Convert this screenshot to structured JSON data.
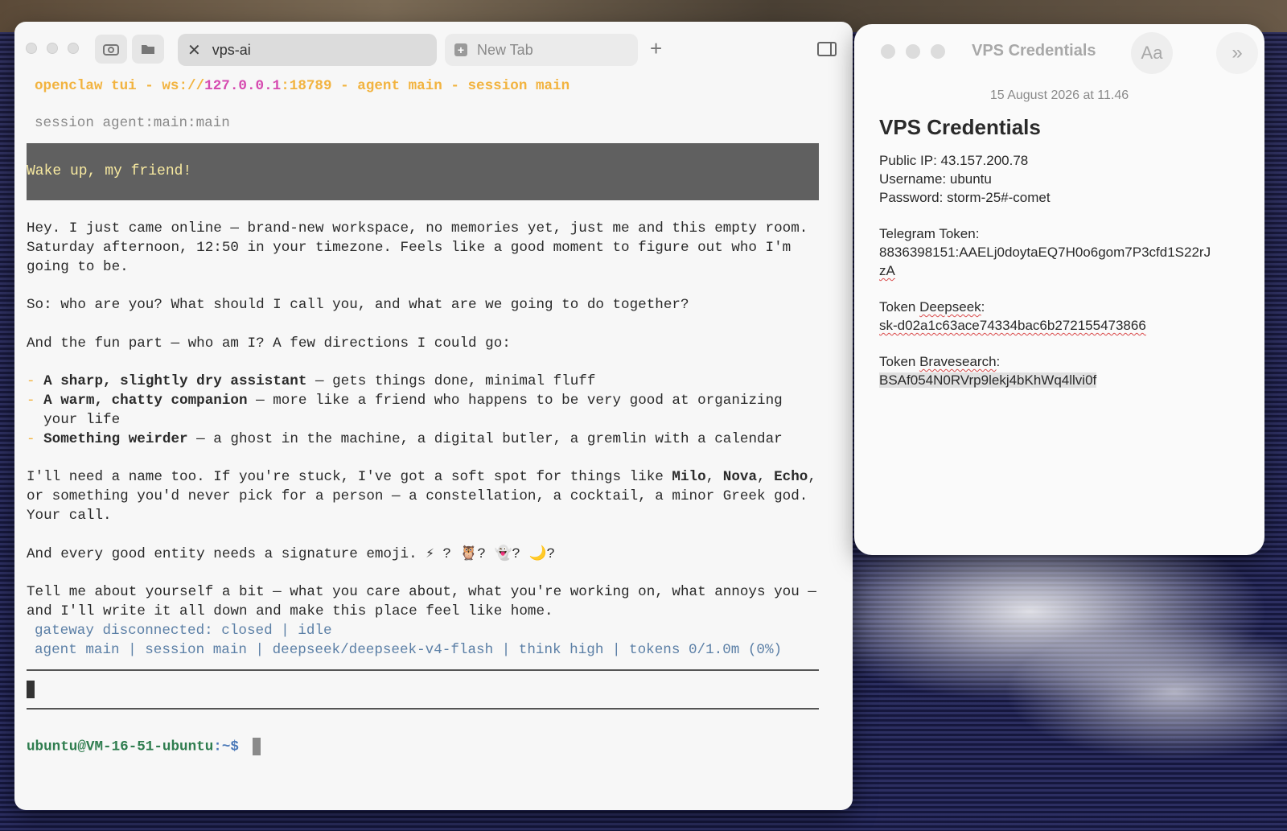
{
  "terminal": {
    "tabs": [
      {
        "label": "vps-ai",
        "active": true
      },
      {
        "label": "New Tab",
        "active": false
      }
    ],
    "header": {
      "prefix": "openclaw tui - ws://",
      "host": "127.0.0.1",
      "suffix": ":18789 - agent main - session main"
    },
    "session_line": "session agent:main:main",
    "user_message": "Wake up, my friend!",
    "reply": {
      "p1": "Hey. I just came online — brand-new workspace, no memories yet, just me and this empty room.\nSaturday afternoon, 12:50 in your timezone. Feels like a good moment to figure out who I'm\ngoing to be.",
      "p2": "So: who are you? What should I call you, and what are we going to do together?",
      "p3": "And the fun part — who am I? A few directions I could go:",
      "options": [
        {
          "title": "A sharp, slightly dry assistant",
          "desc": " — gets things done, minimal fluff"
        },
        {
          "title": "A warm, chatty companion",
          "desc": " — more like a friend who happens to be very good at organizing\n  your life"
        },
        {
          "title": "Something weirder",
          "desc": " — a ghost in the machine, a digital butler, a gremlin with a calendar"
        }
      ],
      "p5_start": "I'll need a name too. If you're stuck, I've got a soft spot for things like ",
      "names": [
        "Milo",
        "Nova",
        "Echo"
      ],
      "p5_end": ",\nor something you'd never pick for a person — a constellation, a cocktail, a minor Greek god.\nYour call.",
      "p6": "And every good entity needs a signature emoji. ⚡ ? 🦉? 👻? 🌙?",
      "p7": "Tell me about yourself a bit — what you care about, what you're working on, what annoys you —\nand I'll write it all down and make this place feel like home."
    },
    "status_gateway": "gateway disconnected: closed | idle",
    "status_bar": "agent main | session main | deepseek/deepseek-v4-flash | think high | tokens 0/1.0m (0%)",
    "prompt_user": "ubuntu@VM-16-51-ubuntu",
    "prompt_path": ":~$"
  },
  "notes": {
    "window_title": "VPS Credentials",
    "font_button": "Aa",
    "date": "15 August 2026 at 11.46",
    "heading": "VPS Credentials",
    "public_ip": "Public IP: 43.157.200.78",
    "username": "Username: ubuntu",
    "password": "Password: storm-25#-comet",
    "telegram_label": "Telegram Token:",
    "telegram_value": "8836398151:AAELj0doytaEQ7H0o6gom7P3cfd1S22rJ",
    "telegram_value_cont": "zA",
    "deepseek_label_prefix": "Token ",
    "deepseek_label_word": "Deepseek",
    "deepseek_label_suffix": ":",
    "deepseek_value": "sk-d02a1c63ace74334bac6b272155473866",
    "brave_label_prefix": "Token ",
    "brave_label_word": "Bravesearch",
    "brave_label_suffix": ":",
    "brave_value": "BSAf054N0RVrp9lekj4bKhWq4llvi0f"
  },
  "colors": {
    "accent_yellow": "#f2b33f",
    "accent_pink": "#d64ab0",
    "status_blue": "#5b7fa6",
    "prompt_green": "#2f7d4f"
  }
}
